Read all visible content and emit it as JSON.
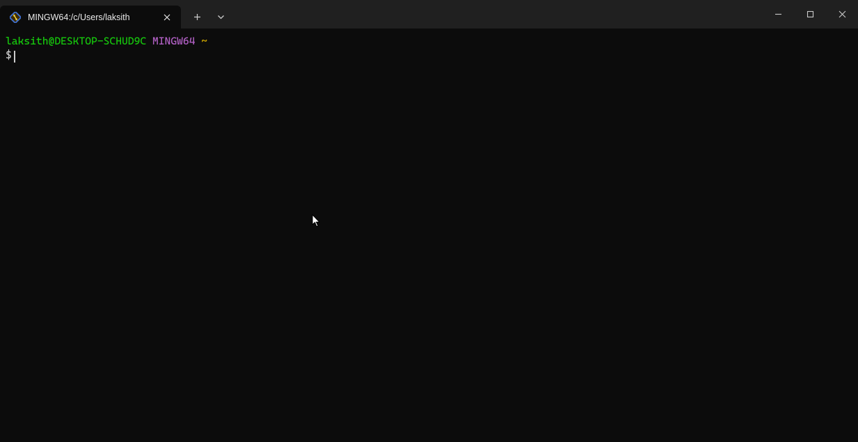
{
  "tab": {
    "title": "MINGW64:/c/Users/laksith"
  },
  "prompt": {
    "user_host": "laksith@DESKTOP-SCHUD9C",
    "env": "MINGW64",
    "path": "~",
    "symbol": "$"
  }
}
